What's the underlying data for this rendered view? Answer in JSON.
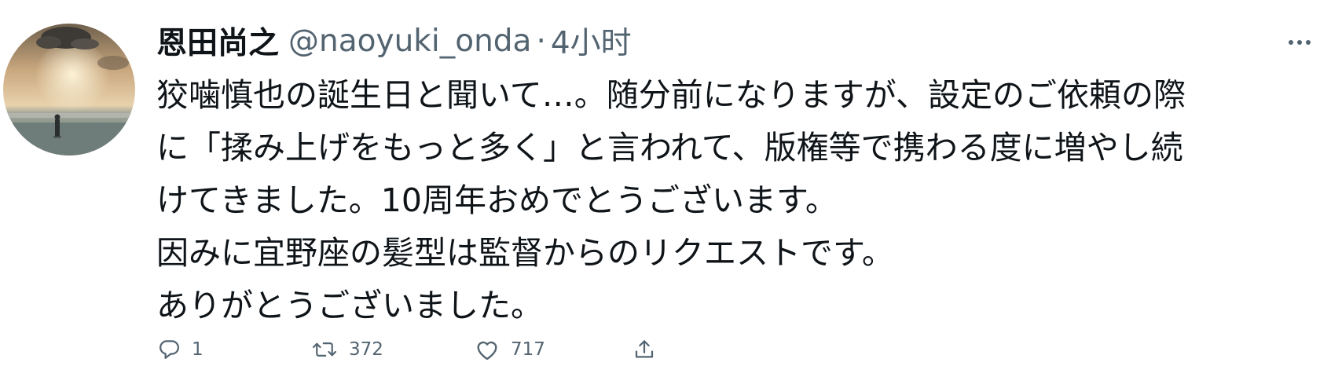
{
  "author": {
    "display_name": "恩田尚之",
    "handle": "@naoyuki_onda",
    "separator": "·",
    "time": "4小时"
  },
  "tweet": {
    "lines": [
      "狡噛慎也の誕生日と聞いて…。随分前になりますが、設定のご依頼の際",
      "に「揉み上げをもっと多く」と言われて、版権等で携わる度に増やし続",
      "けてきました。10周年おめでとうございます。",
      "因みに宜野座の髪型は監督からのリクエストです。",
      "ありがとうございました。"
    ]
  },
  "actions": {
    "reply": {
      "icon": "reply-icon",
      "count": "1"
    },
    "retweet": {
      "icon": "retweet-icon",
      "count": "372"
    },
    "like": {
      "icon": "heart-icon",
      "count": "717"
    },
    "share": {
      "icon": "share-icon"
    }
  },
  "colors": {
    "text": "#0f1419",
    "secondary": "#536471",
    "background": "#ffffff"
  }
}
